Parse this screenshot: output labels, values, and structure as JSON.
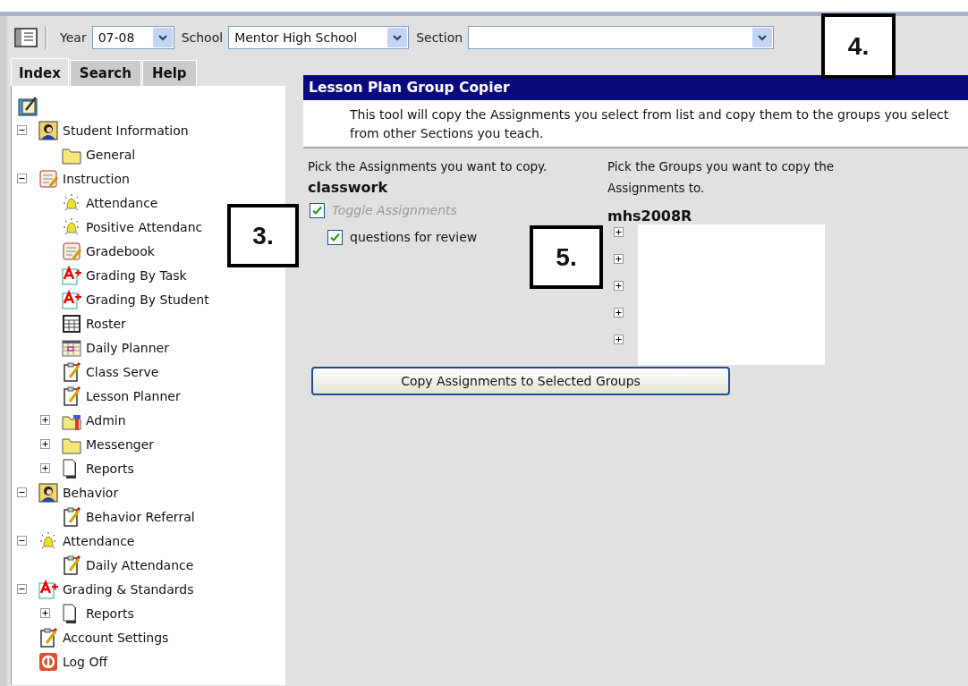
{
  "toolbar": {
    "year": {
      "label": "Year",
      "value": "07-08"
    },
    "school": {
      "label": "School",
      "value": "Mentor High School"
    },
    "section": {
      "label": "Section"
    }
  },
  "tabs": [
    {
      "label": "Index",
      "selected": true
    },
    {
      "label": "Search",
      "selected": false
    },
    {
      "label": "Help",
      "selected": false
    }
  ],
  "tree": [
    {
      "label": "Student Information",
      "kind": "person",
      "expanded": true,
      "children": [
        {
          "label": "General",
          "kind": "folder"
        }
      ]
    },
    {
      "label": "Instruction",
      "kind": "gradebook",
      "expanded": true,
      "children": [
        {
          "label": "Attendance",
          "kind": "bell"
        },
        {
          "label": "Positive Attendanc",
          "kind": "bell"
        },
        {
          "label": "Gradebook",
          "kind": "gradebook"
        },
        {
          "label": "Grading By Task",
          "kind": "aplus"
        },
        {
          "label": "Grading By Student",
          "kind": "aplus"
        },
        {
          "label": "Roster",
          "kind": "grid"
        },
        {
          "label": "Daily Planner",
          "kind": "planner"
        },
        {
          "label": "Class Serve",
          "kind": "clipboard"
        },
        {
          "label": "Lesson Planner",
          "kind": "clipboard"
        },
        {
          "label": "Admin",
          "kind": "tools",
          "expanded": false
        },
        {
          "label": "Messenger",
          "kind": "folder",
          "expanded": false
        },
        {
          "label": "Reports",
          "kind": "page",
          "expanded": false
        }
      ]
    },
    {
      "label": "Behavior",
      "kind": "person",
      "expanded": true,
      "children": [
        {
          "label": "Behavior Referral",
          "kind": "clipboard"
        }
      ]
    },
    {
      "label": "Attendance",
      "kind": "bell",
      "expanded": true,
      "children": [
        {
          "label": "Daily Attendance",
          "kind": "clipboard"
        }
      ]
    },
    {
      "label": "Grading & Standards",
      "kind": "aplus",
      "expanded": true,
      "children": [
        {
          "label": "Reports",
          "kind": "page",
          "expanded": false
        }
      ]
    },
    {
      "label": "Account Settings",
      "kind": "clipboard"
    },
    {
      "label": "Log Off",
      "kind": "logoff"
    }
  ],
  "panel": {
    "title": "Lesson Plan Group Copier",
    "description": "This tool will copy the Assignments you select from list and copy them to the groups you select from other Sections you teach.",
    "assignments_prompt": "Pick the Assignments you want to copy.",
    "groups_prompt": "Pick the Groups you want to copy the Assignments to.",
    "category": "classwork",
    "toggle": {
      "label": "Toggle Assignments",
      "checked": true
    },
    "assignments": [
      {
        "label": "questions for review",
        "checked": true
      }
    ],
    "section_name": "mhs2008R",
    "groups": [
      {
        "expanded": false
      },
      {
        "expanded": false
      },
      {
        "expanded": false
      },
      {
        "expanded": false
      },
      {
        "expanded": false
      }
    ],
    "button": "Copy Assignments to Selected Groups"
  },
  "callouts": [
    {
      "label": "3.",
      "kind": "a"
    },
    {
      "label": "4.",
      "kind": "b"
    },
    {
      "label": "5.",
      "kind": "c"
    }
  ]
}
